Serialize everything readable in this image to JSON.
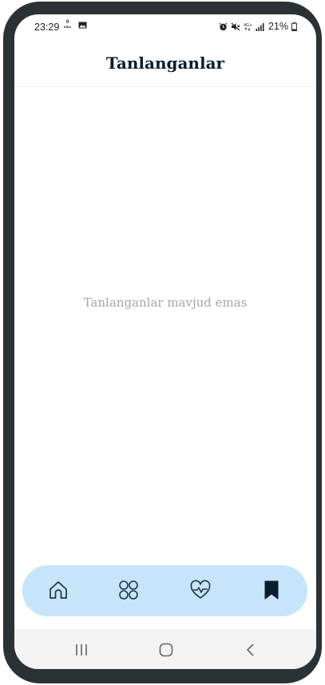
{
  "status_bar": {
    "time": "23:29",
    "net_speed_value": "0",
    "net_speed_unit": "KB/s",
    "battery": "21%",
    "icons": [
      "gallery-icon",
      "alarm-icon",
      "mute-icon",
      "4g-icon",
      "signal-icon",
      "battery-icon"
    ]
  },
  "header": {
    "title": "Tanlanganlar"
  },
  "main": {
    "empty_message": "Tanlanganlar mavjud emas"
  },
  "tabbar": {
    "background": "#c7e5fa",
    "icon_color": "#1f3447",
    "active_color": "#0b1e2e",
    "items": [
      {
        "icon": "home-icon",
        "active": false
      },
      {
        "icon": "categories-icon",
        "active": false
      },
      {
        "icon": "heart-pulse-icon",
        "active": false
      },
      {
        "icon": "bookmark-icon",
        "active": true
      }
    ]
  },
  "system_nav": {
    "icons": [
      "recent-apps-icon",
      "home-circle-icon",
      "back-icon"
    ]
  }
}
